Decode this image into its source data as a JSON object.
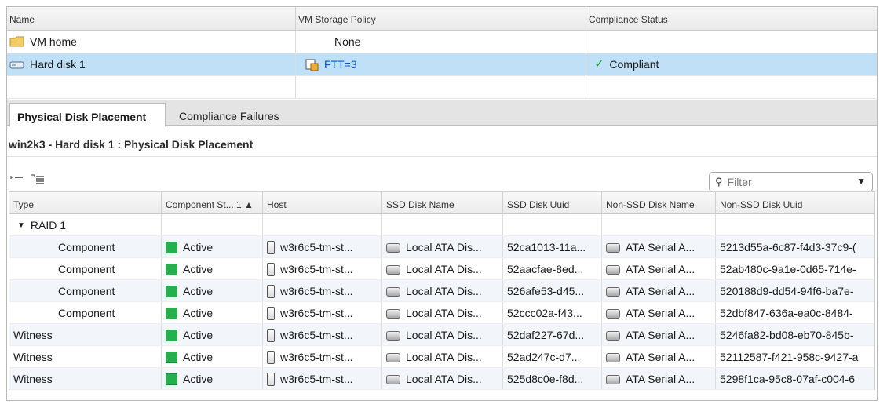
{
  "top": {
    "headers": [
      "Name",
      "VM Storage Policy",
      "Compliance Status"
    ],
    "rows": [
      {
        "name": "VM home",
        "policy": "None",
        "status": ""
      },
      {
        "name": "Hard disk 1",
        "policy": "FTT=3",
        "status": "Compliant"
      },
      {
        "name": "",
        "policy": "",
        "status": ""
      }
    ]
  },
  "tabs": [
    "Physical Disk Placement",
    "Compliance Failures"
  ],
  "panel_title": "win2k3 - Hard disk 1 : Physical Disk Placement",
  "filter": {
    "placeholder": "Filter"
  },
  "grid": {
    "headers": [
      "Type",
      "Component St...  1 ▲",
      "Host",
      "SSD Disk Name",
      "SSD Disk Uuid",
      "Non-SSD Disk Name",
      "Non-SSD Disk Uuid"
    ],
    "group": "RAID 1",
    "rows": [
      {
        "type": "Component",
        "state": "Active",
        "host": "w3r6c5-tm-st...",
        "ssd": "Local ATA Dis...",
        "ssd_uuid": "52ca1013-11a...",
        "nonssd": "ATA Serial A...",
        "nonssd_uuid": "5213d55a-6c87-f4d3-37c9-("
      },
      {
        "type": "Component",
        "state": "Active",
        "host": "w3r6c5-tm-st...",
        "ssd": "Local ATA Dis...",
        "ssd_uuid": "52aacfae-8ed...",
        "nonssd": "ATA Serial A...",
        "nonssd_uuid": "52ab480c-9a1e-0d65-714e-"
      },
      {
        "type": "Component",
        "state": "Active",
        "host": "w3r6c5-tm-st...",
        "ssd": "Local ATA Dis...",
        "ssd_uuid": "526afe53-d45...",
        "nonssd": "ATA Serial A...",
        "nonssd_uuid": "520188d9-dd54-94f6-ba7e-"
      },
      {
        "type": "Component",
        "state": "Active",
        "host": "w3r6c5-tm-st...",
        "ssd": "Local ATA Dis...",
        "ssd_uuid": "52ccc02a-f43...",
        "nonssd": "ATA Serial A...",
        "nonssd_uuid": "52dbf847-636a-ea0c-8484-"
      },
      {
        "type": "Witness",
        "state": "Active",
        "host": "w3r6c5-tm-st...",
        "ssd": "Local ATA Dis...",
        "ssd_uuid": "52daf227-67d...",
        "nonssd": "ATA Serial A...",
        "nonssd_uuid": "5246fa82-bd08-eb70-845b-"
      },
      {
        "type": "Witness",
        "state": "Active",
        "host": "w3r6c5-tm-st...",
        "ssd": "Local ATA Dis...",
        "ssd_uuid": "52ad247c-d7...",
        "nonssd": "ATA Serial A...",
        "nonssd_uuid": "52112587-f421-958c-9427-a"
      },
      {
        "type": "Witness",
        "state": "Active",
        "host": "w3r6c5-tm-st...",
        "ssd": "Local ATA Dis...",
        "ssd_uuid": "525d8c0e-f8d...",
        "nonssd": "ATA Serial A...",
        "nonssd_uuid": "5298f1ca-95c8-07af-c004-6"
      }
    ]
  },
  "colors": {
    "selection": "#bfe0f7",
    "active_green": "#24b04a",
    "link_blue": "#0a59c8"
  }
}
